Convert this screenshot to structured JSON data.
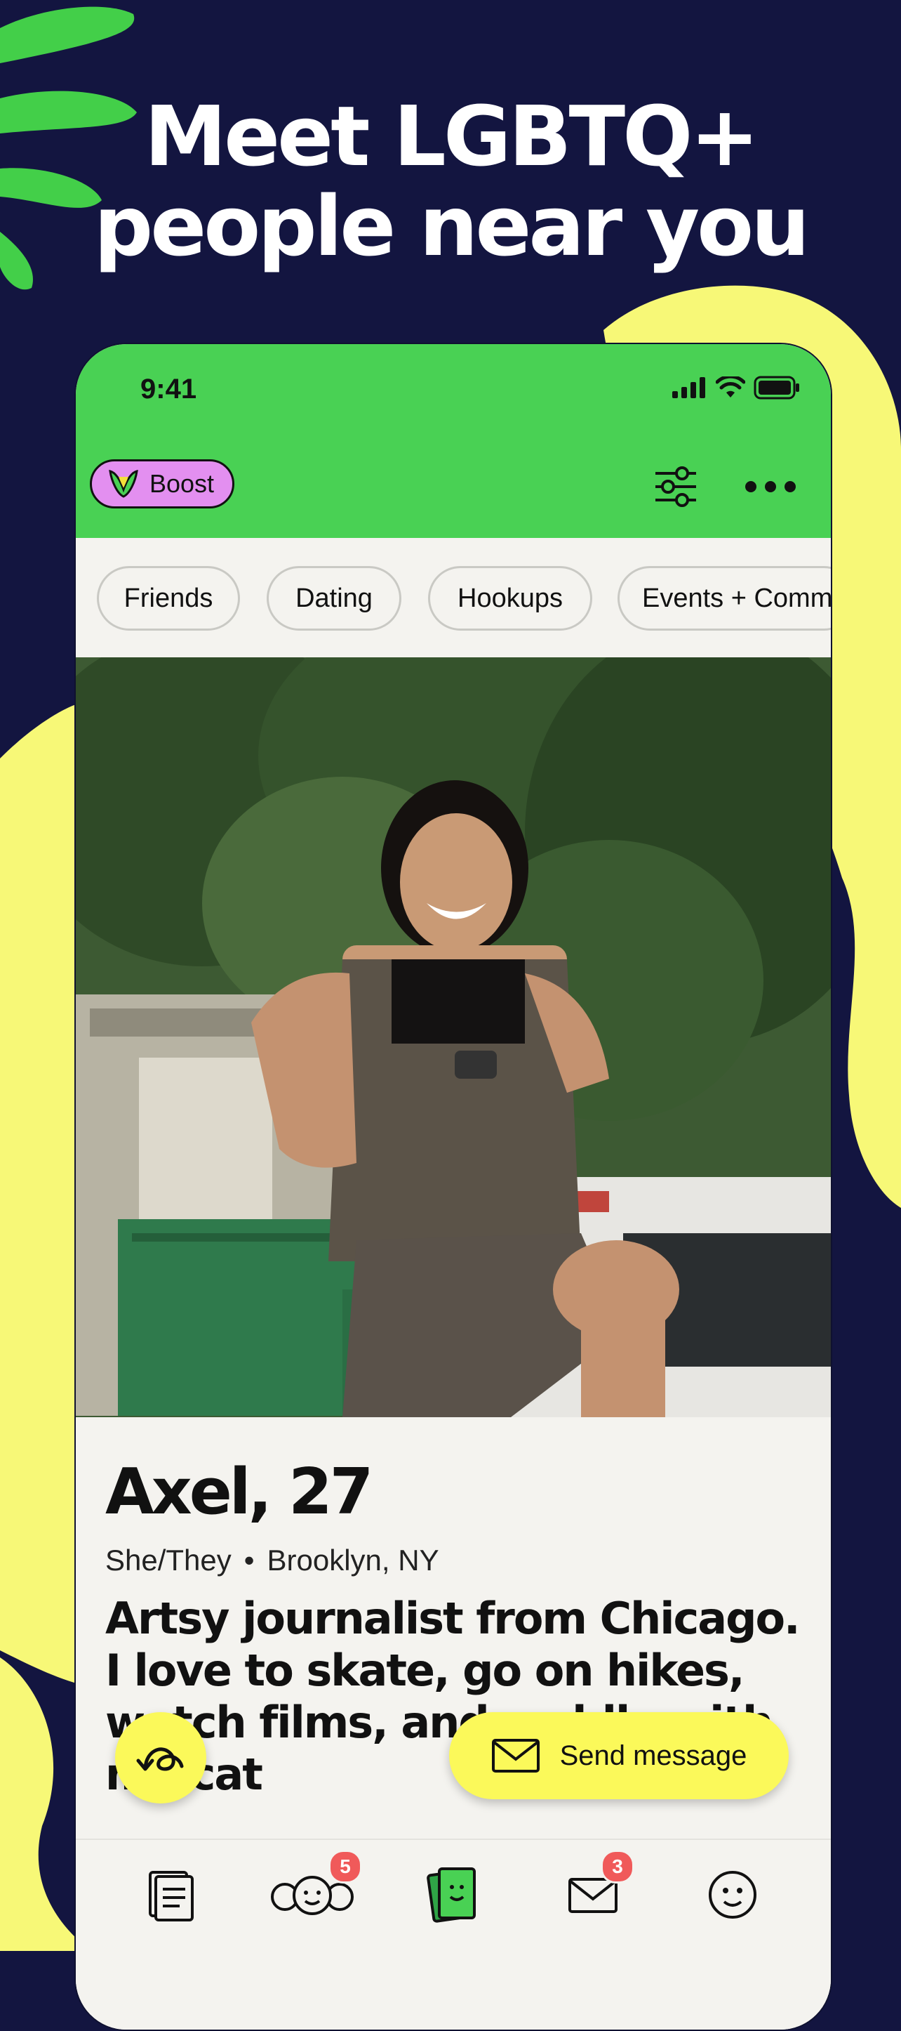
{
  "headline": {
    "line1": "Meet LGBTQ+",
    "line2": "people near you"
  },
  "status_bar": {
    "time": "9:41"
  },
  "header": {
    "boost_label": "Boost"
  },
  "chips": [
    "Friends",
    "Dating",
    "Hookups",
    "Events + Comm"
  ],
  "profile": {
    "name_age": "Axel, 27",
    "pronouns": "She/They",
    "separator": "•",
    "location": "Brooklyn, NY",
    "bio": "Artsy journalist from Chicago. I love to skate, go on hikes, watch films, and cuddle with my cat"
  },
  "actions": {
    "send_message_label": "Send message"
  },
  "tabs": [
    {
      "name": "feed",
      "badge": ""
    },
    {
      "name": "people",
      "badge": "5"
    },
    {
      "name": "profiles",
      "badge": ""
    },
    {
      "name": "messages",
      "badge": "3"
    },
    {
      "name": "me",
      "badge": ""
    }
  ],
  "colors": {
    "background": "#131540",
    "green": "#49d154",
    "yellow": "#fbf95a",
    "boost": "#e38ff0",
    "badge": "#f05a5a"
  },
  "icons": [
    "signal-icon",
    "wifi-icon",
    "battery-icon",
    "filter-icon",
    "more-icon",
    "undo-icon",
    "envelope-icon",
    "feed-icon",
    "people-icon",
    "profile-card-icon",
    "mail-icon",
    "face-icon"
  ]
}
